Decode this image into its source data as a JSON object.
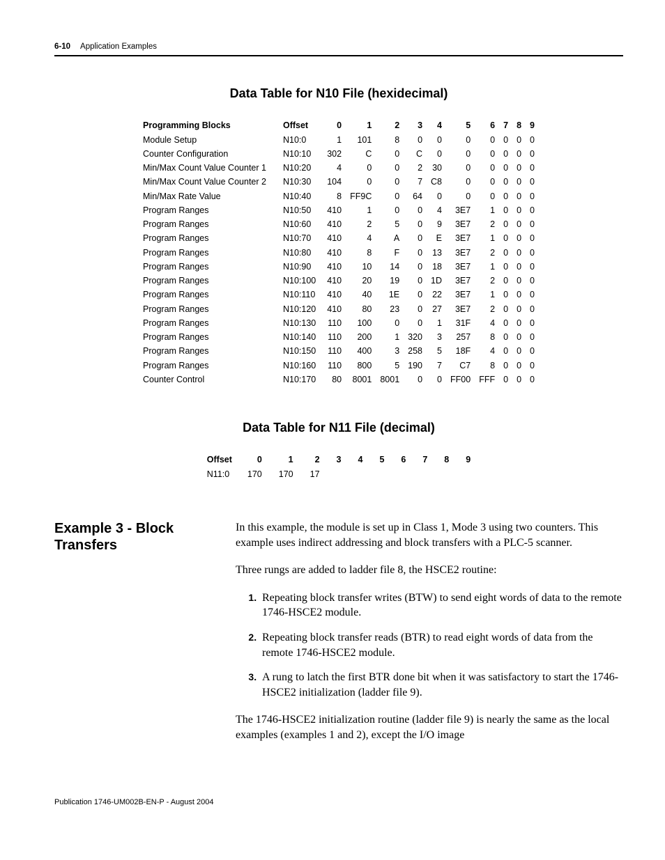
{
  "header": {
    "page_num": "6-10",
    "section": "Application Examples"
  },
  "table_n10": {
    "title": "Data Table for N10 File (hexidecimal)",
    "head_label": "Programming Blocks",
    "head_offset": "Offset",
    "cols": [
      "0",
      "1",
      "2",
      "3",
      "4",
      "5",
      "6",
      "7",
      "8",
      "9"
    ],
    "rows": [
      {
        "label": "Module Setup",
        "offset": "N10:0",
        "v": [
          "1",
          "101",
          "8",
          "0",
          "0",
          "0",
          "0",
          "0",
          "0",
          "0"
        ]
      },
      {
        "label": "Counter Configuration",
        "offset": "N10:10",
        "v": [
          "302",
          "C",
          "0",
          "C",
          "0",
          "0",
          "0",
          "0",
          "0",
          "0"
        ]
      },
      {
        "label": "Min/Max Count Value Counter 1",
        "offset": "N10:20",
        "v": [
          "4",
          "0",
          "0",
          "2",
          "30",
          "0",
          "0",
          "0",
          "0",
          "0"
        ]
      },
      {
        "label": "Min/Max Count Value Counter 2",
        "offset": "N10:30",
        "v": [
          "104",
          "0",
          "0",
          "7",
          "C8",
          "0",
          "0",
          "0",
          "0",
          "0"
        ]
      },
      {
        "label": "Min/Max Rate Value",
        "offset": "N10:40",
        "v": [
          "8",
          "FF9C",
          "0",
          "64",
          "0",
          "0",
          "0",
          "0",
          "0",
          "0"
        ]
      },
      {
        "label": "Program Ranges",
        "offset": "N10:50",
        "v": [
          "410",
          "1",
          "0",
          "0",
          "4",
          "3E7",
          "1",
          "0",
          "0",
          "0"
        ]
      },
      {
        "label": "Program Ranges",
        "offset": "N10:60",
        "v": [
          "410",
          "2",
          "5",
          "0",
          "9",
          "3E7",
          "2",
          "0",
          "0",
          "0"
        ]
      },
      {
        "label": "Program Ranges",
        "offset": "N10:70",
        "v": [
          "410",
          "4",
          "A",
          "0",
          "E",
          "3E7",
          "1",
          "0",
          "0",
          "0"
        ]
      },
      {
        "label": "Program Ranges",
        "offset": "N10:80",
        "v": [
          "410",
          "8",
          "F",
          "0",
          "13",
          "3E7",
          "2",
          "0",
          "0",
          "0"
        ]
      },
      {
        "label": "Program Ranges",
        "offset": "N10:90",
        "v": [
          "410",
          "10",
          "14",
          "0",
          "18",
          "3E7",
          "1",
          "0",
          "0",
          "0"
        ]
      },
      {
        "label": "Program Ranges",
        "offset": "N10:100",
        "v": [
          "410",
          "20",
          "19",
          "0",
          "1D",
          "3E7",
          "2",
          "0",
          "0",
          "0"
        ]
      },
      {
        "label": "Program Ranges",
        "offset": "N10:110",
        "v": [
          "410",
          "40",
          "1E",
          "0",
          "22",
          "3E7",
          "1",
          "0",
          "0",
          "0"
        ]
      },
      {
        "label": "Program Ranges",
        "offset": "N10:120",
        "v": [
          "410",
          "80",
          "23",
          "0",
          "27",
          "3E7",
          "2",
          "0",
          "0",
          "0"
        ]
      },
      {
        "label": "Program Ranges",
        "offset": "N10:130",
        "v": [
          "110",
          "100",
          "0",
          "0",
          "1",
          "31F",
          "4",
          "0",
          "0",
          "0"
        ]
      },
      {
        "label": "Program Ranges",
        "offset": "N10:140",
        "v": [
          "110",
          "200",
          "1",
          "320",
          "3",
          "257",
          "8",
          "0",
          "0",
          "0"
        ]
      },
      {
        "label": "Program Ranges",
        "offset": "N10:150",
        "v": [
          "110",
          "400",
          "3",
          "258",
          "5",
          "18F",
          "4",
          "0",
          "0",
          "0"
        ]
      },
      {
        "label": "Program Ranges",
        "offset": "N10:160",
        "v": [
          "110",
          "800",
          "5",
          "190",
          "7",
          "C7",
          "8",
          "0",
          "0",
          "0"
        ]
      },
      {
        "label": "Counter Control",
        "offset": "N10:170",
        "v": [
          "80",
          "8001",
          "8001",
          "0",
          "0",
          "FF00",
          "FFF",
          "0",
          "0",
          "0"
        ]
      }
    ]
  },
  "table_n11": {
    "title": "Data Table for N11 File (decimal)",
    "head_offset": "Offset",
    "cols": [
      "0",
      "1",
      "2",
      "3",
      "4",
      "5",
      "6",
      "7",
      "8",
      "9"
    ],
    "rows": [
      {
        "offset": "N11:0",
        "v": [
          "170",
          "170",
          "17",
          "",
          "",
          "",
          "",
          "",
          "",
          ""
        ]
      }
    ]
  },
  "example": {
    "heading": "Example 3 - Block Transfers",
    "para1": "In this example, the module is set up in Class 1, Mode 3 using two counters. This example uses indirect addressing and block transfers with a PLC-5 scanner.",
    "para2": "Three rungs are added to ladder file 8, the HSCE2 routine:",
    "steps": [
      "Repeating block transfer writes (BTW) to send eight words of data to the remote 1746-HSCE2 module.",
      "Repeating block transfer reads (BTR) to read eight words of data from the remote 1746-HSCE2 module.",
      "A rung to latch the first BTR done bit when it was satisfactory to start the 1746-HSCE2 initialization (ladder file 9)."
    ],
    "para3": "The 1746-HSCE2 initialization routine (ladder file 9) is nearly the same as the local examples (examples 1 and 2), except the I/O image"
  },
  "footer": "Publication 1746-UM002B-EN-P - August 2004"
}
